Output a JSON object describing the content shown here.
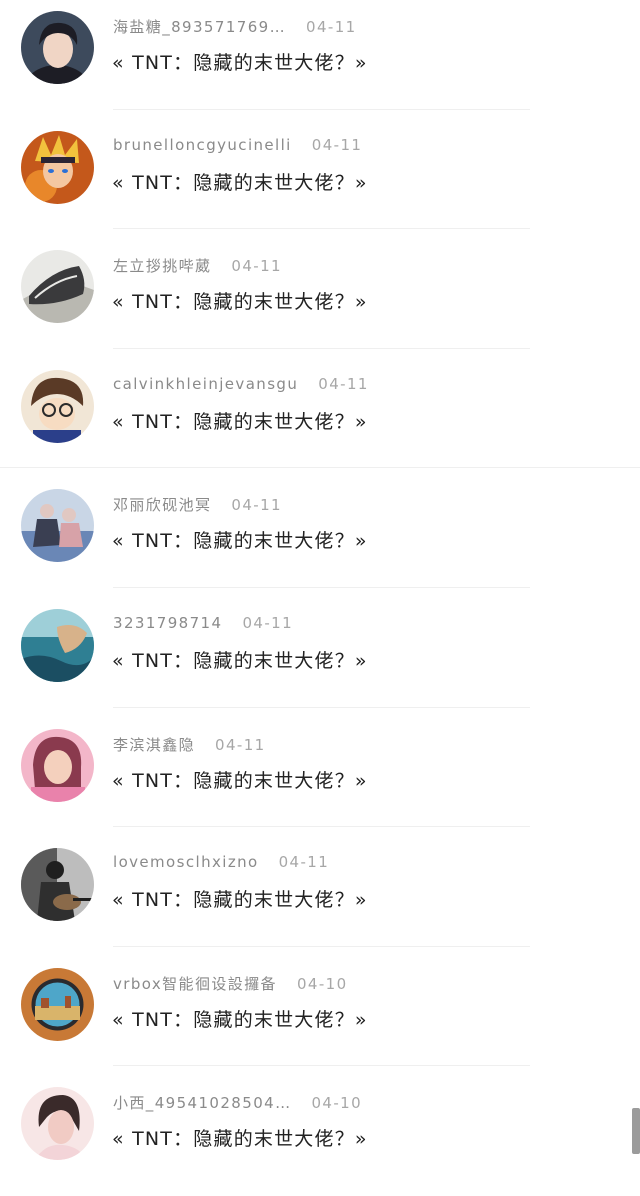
{
  "comments": [
    {
      "user": "海盐糖_893571769…",
      "date": "04-11",
      "text": "« TNT：隐藏的末世大佬？»",
      "avatar": "avatar-young-man-icon",
      "colors": [
        "#3d4a5c",
        "#f0d5c5",
        "#1d1d25"
      ]
    },
    {
      "user": "brunelloncgyucinelli",
      "date": "04-11",
      "text": "« TNT：隐藏的末世大佬？»",
      "avatar": "avatar-anime-ninja-icon",
      "colors": [
        "#c4581b",
        "#f2c23d",
        "#2b2433"
      ]
    },
    {
      "user": "左立拶挑哔葳",
      "date": "04-11",
      "text": "« TNT：隐藏的末世大佬？»",
      "avatar": "avatar-sneakers-icon",
      "colors": [
        "#b9b8b1",
        "#3a3a3c",
        "#e9e9e6"
      ]
    },
    {
      "user": "calvinkhleinjevansgu",
      "date": "04-11",
      "text": "« TNT：隐藏的末世大佬？»",
      "avatar": "avatar-anime-detective-icon",
      "colors": [
        "#f1e6d6",
        "#5a3a26",
        "#2b3f8a"
      ]
    },
    {
      "user": "邓丽欣砚池冥",
      "date": "04-11",
      "text": "« TNT：隐藏的末世大佬？»",
      "avatar": "avatar-couple-photo-icon",
      "colors": [
        "#6a87b6",
        "#e1c8c2",
        "#3a3f52"
      ]
    },
    {
      "user": "3231798714",
      "date": "04-11",
      "text": "« TNT：隐藏的末世大佬？»",
      "avatar": "avatar-ocean-photo-icon",
      "colors": [
        "#2f7f93",
        "#d7b28a",
        "#1b4e62"
      ]
    },
    {
      "user": "李滨淇鑫隐",
      "date": "04-11",
      "text": "« TNT：隐藏的末世大佬？»",
      "avatar": "avatar-pink-girl-icon",
      "colors": [
        "#e982ab",
        "#f4d0bd",
        "#8a3a4e"
      ]
    },
    {
      "user": "lovemosclhxizno",
      "date": "04-11",
      "text": "« TNT：隐藏的末世大佬？»",
      "avatar": "avatar-guitarist-icon",
      "colors": [
        "#5a5a5a",
        "#1f1f1f",
        "#bdbdbd"
      ]
    },
    {
      "user": "vrbox智能徊设設攞备",
      "date": "04-10",
      "text": "« TNT：隐藏的末世大佬？»",
      "avatar": "avatar-vr-lens-icon",
      "colors": [
        "#c87936",
        "#4ea6c9",
        "#2a2a2e"
      ]
    },
    {
      "user": "小西_49541028504…",
      "date": "04-10",
      "text": "« TNT：隐藏的末世大佬？»",
      "avatar": "avatar-girl-portrait-icon",
      "colors": [
        "#f1cbc4",
        "#3a2a2a",
        "#f7e6e6"
      ]
    }
  ]
}
